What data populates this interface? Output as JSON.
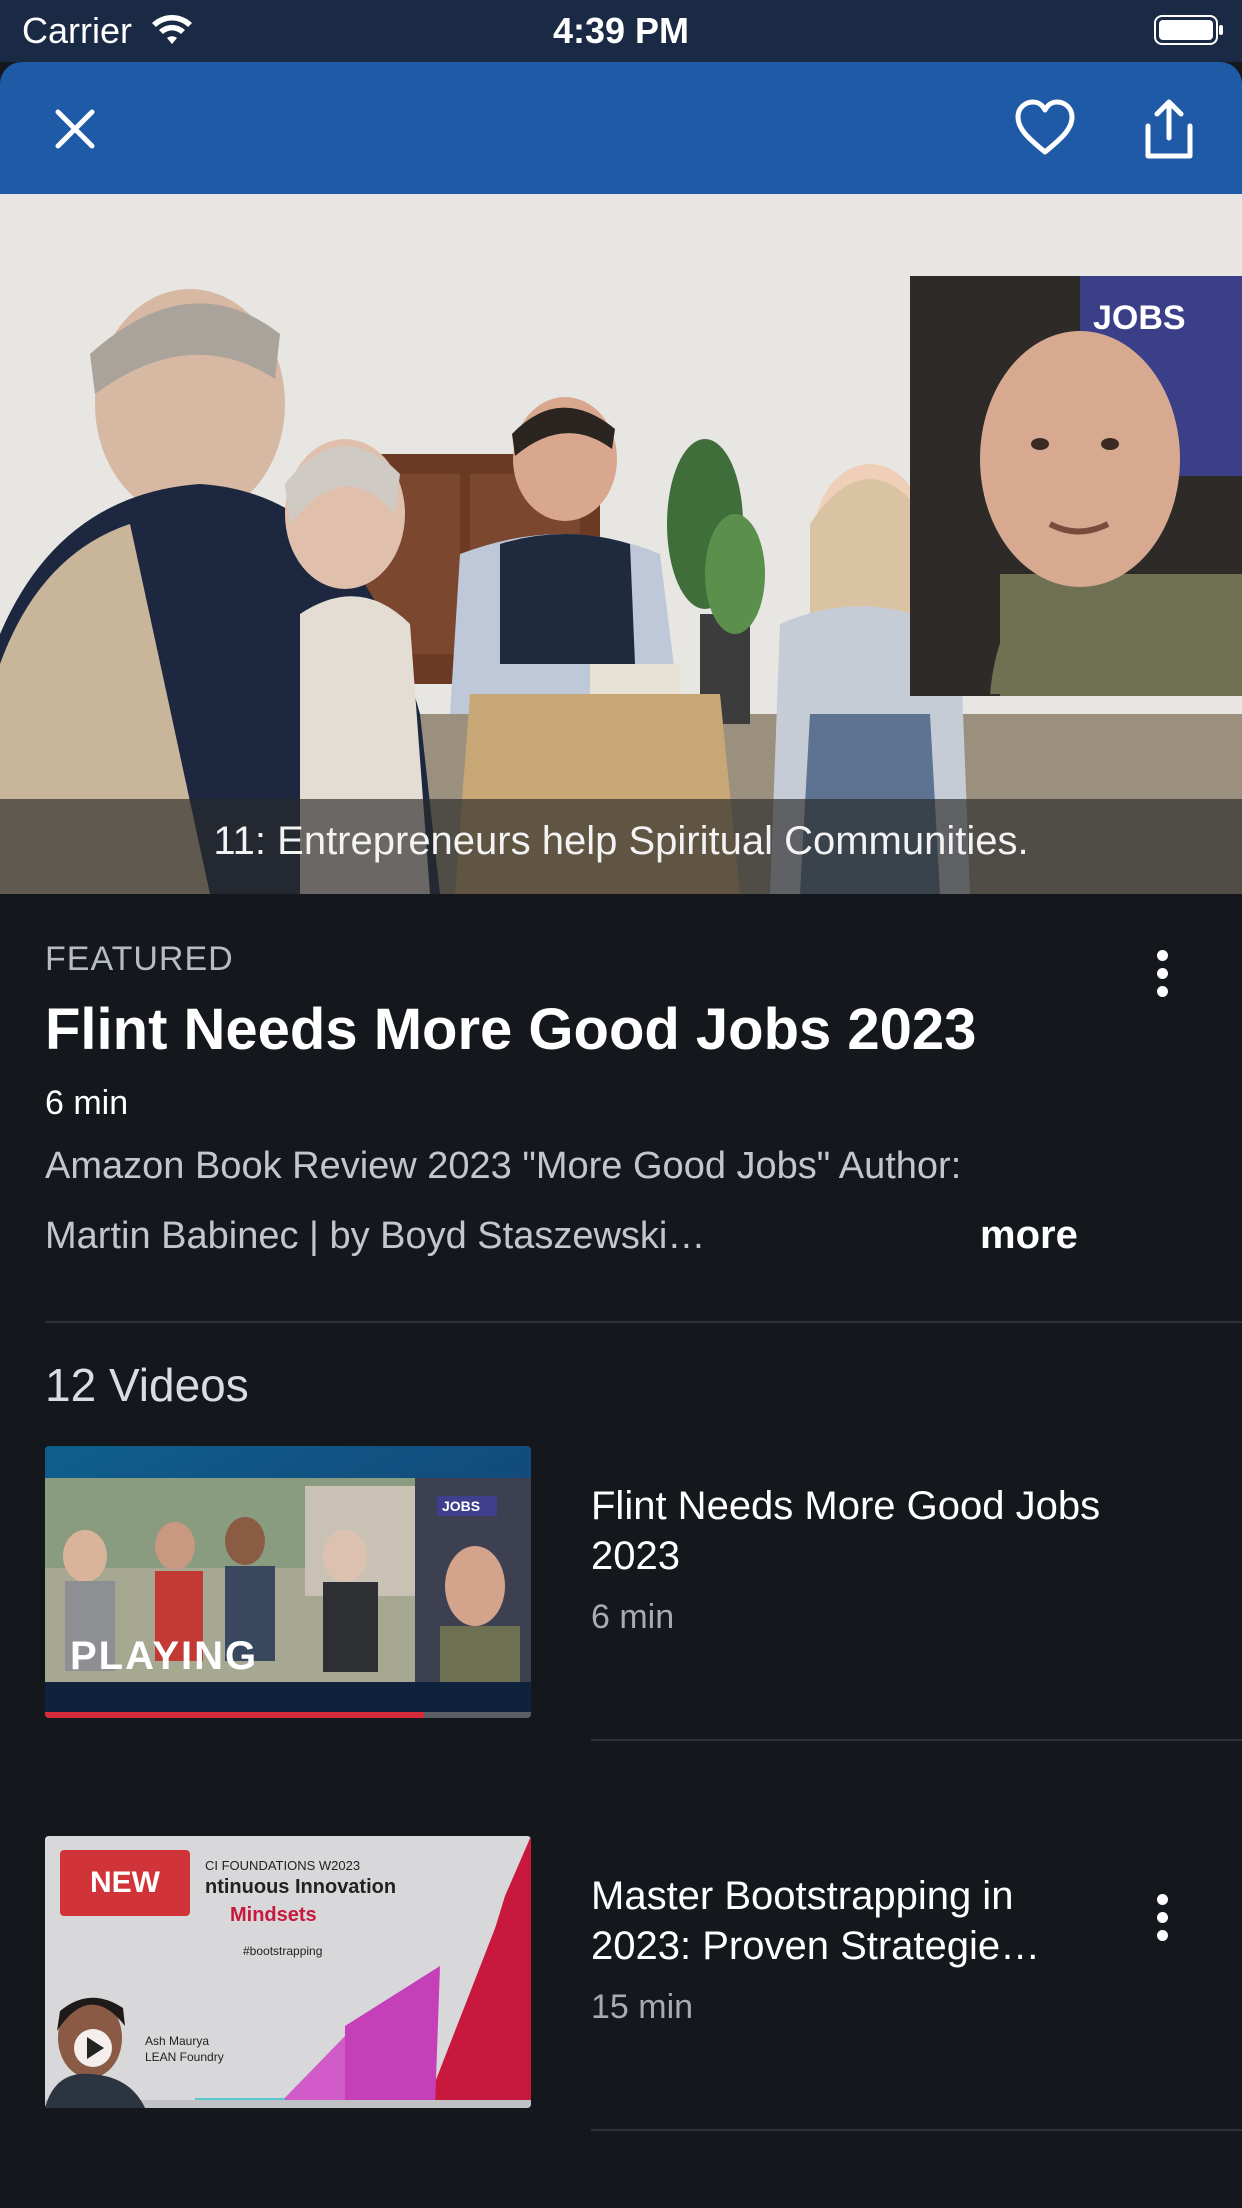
{
  "status_bar": {
    "carrier": "Carrier",
    "time": "4:39 PM"
  },
  "nav": {
    "close_icon": "close-icon",
    "favorite_icon": "heart-icon",
    "share_icon": "share-icon"
  },
  "player": {
    "subtitle": "11: Entrepreneurs help Spiritual Communities."
  },
  "featured": {
    "label": "FEATURED",
    "title": "Flint Needs More Good Jobs 2023",
    "duration": "6 min",
    "description_line1": "Amazon Book Review 2023 \"More Good Jobs\" Author:",
    "description_line2": "Martin Babinec | by Boyd Staszewski…",
    "more_label": "more"
  },
  "videos": {
    "count_label": "12 Videos",
    "items": [
      {
        "title": "Flint Needs More Good Jobs 2023",
        "duration": "6 min",
        "badge": "PLAYING",
        "thumb_poster_text": "JOBS",
        "progress": 0.78
      },
      {
        "title": "Master Bootstrapping in 2023: Proven Strategie…",
        "duration": "15 min",
        "badge": "NEW",
        "thumb_header": "CI FOUNDATIONS W2023",
        "thumb_title": "ntinuous Innovation",
        "thumb_subtitle": "Mindsets",
        "thumb_tag": "#bootstrapping",
        "thumb_author": "Ash Maurya",
        "thumb_org": "LEAN Foundry"
      }
    ]
  },
  "colors": {
    "nav_bar": "#1f5aa6",
    "background": "#14171b",
    "progress": "#d62b3a",
    "new_badge": "#d13438"
  }
}
